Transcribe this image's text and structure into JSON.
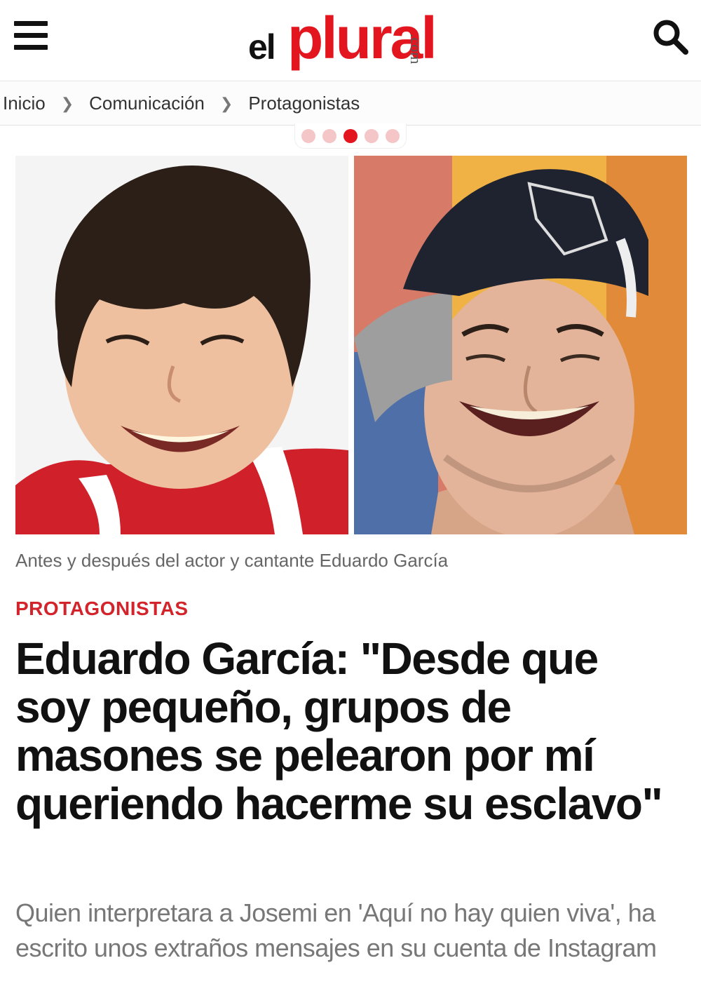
{
  "header": {
    "logo_el": "el",
    "logo_plural": "plural",
    "logo_com": ".com"
  },
  "breadcrumb": {
    "items": [
      "Inicio",
      "Comunicación",
      "Protagonistas"
    ]
  },
  "pager": {
    "count": 5,
    "active_index": 2,
    "colors": {
      "inactive": "#f5c6c8",
      "active": "#e3161f"
    }
  },
  "article": {
    "caption": "Antes y después del actor y cantante Eduardo García",
    "category": "PROTAGONISTAS",
    "title": "Eduardo García: \"Desde que soy pequeño, grupos de masones se pelearon por mí queriendo hacerme su esclavo\"",
    "subtitle": "Quien interpretara a Josemi en 'Aquí no hay quien viva', ha escrito unos extraños mensajes en su cuenta de Instagram"
  },
  "icons": {
    "menu": "hamburger-menu-icon",
    "search": "search-icon",
    "separator": "chevron-right-icon"
  }
}
